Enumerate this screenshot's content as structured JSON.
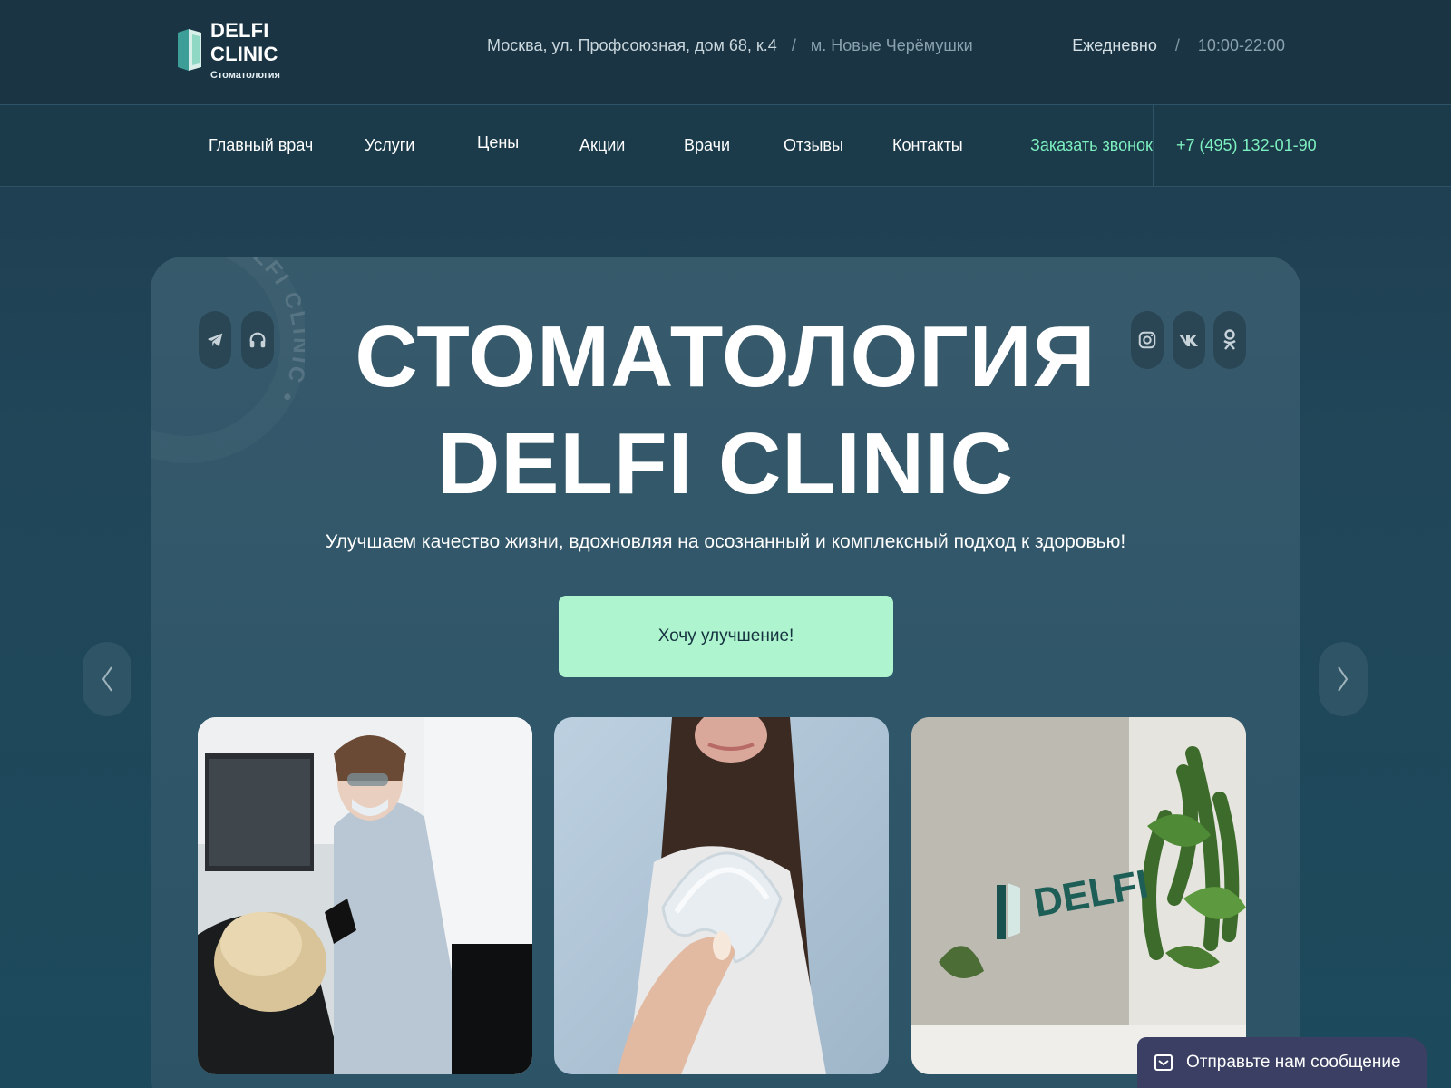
{
  "header": {
    "logo_title": "DELFI CLINIC",
    "logo_subtitle": "Стоматология",
    "address": "Москва, ул. Профсоюзная, дом 68, к.4",
    "separator": "/",
    "metro": "м. Новые Черёмушки",
    "hours_label": "Ежедневно",
    "hours_time": "10:00-22:00"
  },
  "nav": {
    "items": [
      "Главный врач",
      "Услуги",
      "Цены",
      "Акции",
      "Врачи",
      "Отзывы",
      "Контакты"
    ],
    "callback": "Заказать звонок",
    "phone": "+7 (495) 132-01-90"
  },
  "hero": {
    "title_line1": "СТОМАТОЛОГИЯ",
    "title_line2": "DELFI CLINIC",
    "subtitle": "Улучшаем качество жизни, вдохновляя на осознанный и комплексный подход к здоровью!",
    "cta": "Хочу улучшение!",
    "badge_text": "DELFI CLINIC • DELFI CLINIC •",
    "photo3_sign": "DELFI"
  },
  "widget": {
    "label": "Отправьте нам сообщение"
  },
  "colors": {
    "accent": "#7df0bf",
    "cta_bg": "#aef5cf",
    "header_bg": "#1a3444"
  }
}
